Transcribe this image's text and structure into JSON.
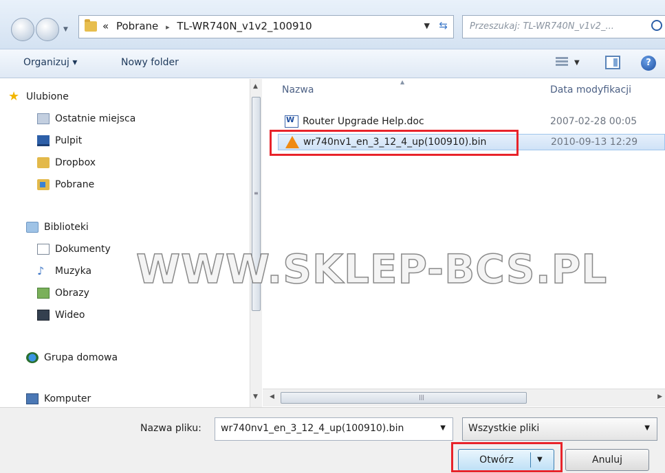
{
  "address": {
    "overflow": "«",
    "crumbs": [
      "Pobrane",
      "TL-WR740N_v1v2_100910"
    ],
    "separator": "▸"
  },
  "search": {
    "placeholder": "Przeszukaj: TL-WR740N_v1v2_..."
  },
  "toolbar": {
    "organize": "Organizuj ▾",
    "new_folder": "Nowy folder",
    "help": "?"
  },
  "nav": {
    "favorites": "Ulubione",
    "recent": "Ostatnie miejsca",
    "desktop": "Pulpit",
    "dropbox": "Dropbox",
    "downloads": "Pobrane",
    "libraries": "Biblioteki",
    "documents": "Dokumenty",
    "music": "Muzyka",
    "pictures": "Obrazy",
    "video": "Wideo",
    "homegroup": "Grupa domowa",
    "computer": "Komputer"
  },
  "files": {
    "col_name": "Nazwa",
    "col_date": "Data modyfikacji",
    "rows": [
      {
        "name": "Router Upgrade Help.doc",
        "date": "2007-02-28 00:05",
        "icon": "word-icon"
      },
      {
        "name": "wr740nv1_en_3_12_4_up(100910).bin",
        "date": "2010-09-13 12:29",
        "icon": "vlc-icon"
      }
    ]
  },
  "watermark": "WWW.SKLEP-BCS.PL",
  "bottom": {
    "filename_label": "Nazwa pliku:",
    "filename_value": "wr740nv1_en_3_12_4_up(100910).bin",
    "filter_value": "Wszystkie pliki",
    "open_label": "Otwórz",
    "cancel_label": "Anuluj"
  },
  "colors": {
    "highlight": "#e8232a",
    "selection": "#cfe2f7"
  }
}
